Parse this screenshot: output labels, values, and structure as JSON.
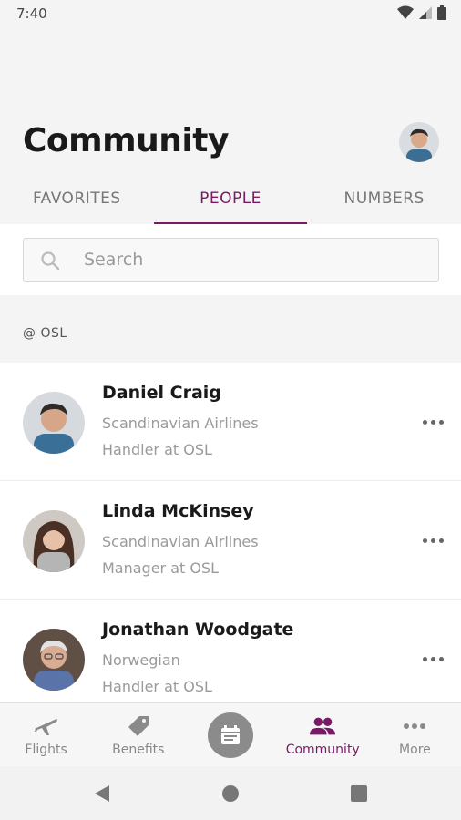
{
  "status_bar": {
    "time": "7:40",
    "icons": [
      "wifi-icon",
      "signal-icon",
      "battery-icon"
    ]
  },
  "header": {
    "title": "Community",
    "profile_avatar": "profile-avatar"
  },
  "tabs": [
    {
      "label": "FAVORITES",
      "active": false
    },
    {
      "label": "PEOPLE",
      "active": true
    },
    {
      "label": "NUMBERS",
      "active": false
    }
  ],
  "search": {
    "placeholder": "Search",
    "value": ""
  },
  "section": {
    "label": "@ OSL"
  },
  "people": [
    {
      "name": "Daniel Craig",
      "company": "Scandinavian Airlines",
      "role": "Handler at OSL"
    },
    {
      "name": "Linda McKinsey",
      "company": "Scandinavian Airlines",
      "role": "Manager at OSL"
    },
    {
      "name": "Jonathan Woodgate",
      "company": "Norwegian",
      "role": "Handler at OSL"
    }
  ],
  "bottom_nav": [
    {
      "label": "Flights",
      "icon": "airplane-icon"
    },
    {
      "label": "Benefits",
      "icon": "tag-icon"
    },
    {
      "label": "",
      "icon": "calendar-icon"
    },
    {
      "label": "Community",
      "icon": "people-icon",
      "active": true
    },
    {
      "label": "More",
      "icon": "more-icon"
    }
  ],
  "colors": {
    "accent": "#7a1a66",
    "background": "#f4f4f4",
    "muted_text": "#9a9a9a"
  }
}
